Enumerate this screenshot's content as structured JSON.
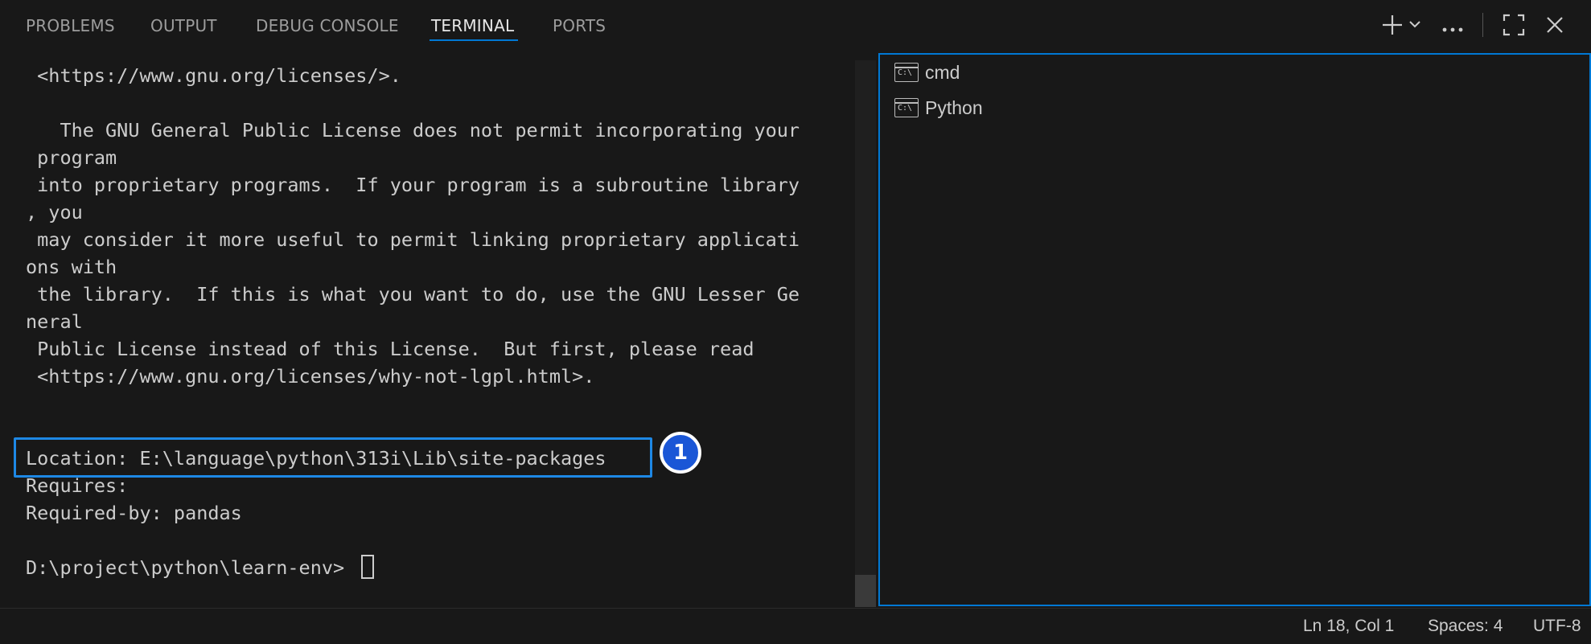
{
  "tabs": [
    {
      "label": "PROBLEMS"
    },
    {
      "label": "OUTPUT"
    },
    {
      "label": "DEBUG CONSOLE"
    },
    {
      "label": "TERMINAL",
      "active": true
    },
    {
      "label": "PORTS"
    }
  ],
  "toolbar": {
    "new_terminal_icon": "plus-icon",
    "dropdown_icon": "chevron-down-icon",
    "more_icon": "ellipsis-icon",
    "maximize_icon": "maximize-icon",
    "close_icon": "close-icon"
  },
  "terminal": {
    "lines": [
      " <https://www.gnu.org/licenses/>.",
      "",
      "   The GNU General Public License does not permit incorporating your",
      " program",
      " into proprietary programs.  If your program is a subroutine library",
      ", you",
      " may consider it more useful to permit linking proprietary applicati",
      "ons with",
      " the library.  If this is what you want to do, use the GNU Lesser Ge",
      "neral",
      " Public License instead of this License.  But first, please read",
      " <https://www.gnu.org/licenses/why-not-lgpl.html>.",
      "",
      "",
      "Location: E:\\language\\python\\313i\\Lib\\site-packages",
      "Requires:",
      "Required-by: pandas",
      "",
      "D:\\project\\python\\learn-env>"
    ],
    "marker_label": "1"
  },
  "terminal_list": [
    {
      "label": "cmd",
      "icon": "cmd-terminal-icon",
      "icon_text": "C:\\"
    },
    {
      "label": "Python",
      "icon": "cmd-terminal-icon",
      "icon_text": "C:\\"
    }
  ],
  "statusbar": {
    "position": "Ln 18, Col 1",
    "spaces": "Spaces: 4",
    "encoding": "UTF-8"
  },
  "colors": {
    "background": "#181818",
    "accent": "#0078d4",
    "highlight": "#1e88e5",
    "marker": "#1a56d6"
  }
}
